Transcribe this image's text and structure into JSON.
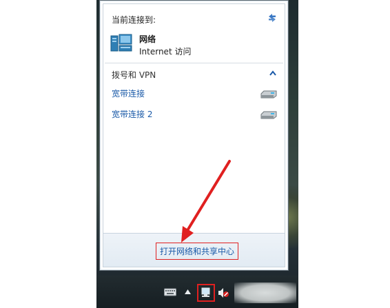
{
  "panel": {
    "connected_label": "当前连接到:",
    "network": {
      "name": "网络",
      "status": "Internet 访问",
      "icon": "network-icon"
    },
    "dialup_section": "拨号和 VPN",
    "connections": [
      {
        "label": "宽带连接",
        "icon": "modem-icon"
      },
      {
        "label": "宽带连接 2",
        "icon": "modem-icon"
      }
    ],
    "open_center_link": "打开网络和共享中心"
  },
  "taskbar": {
    "tray_icons": [
      "keyboard-icon",
      "show-hidden-icons-arrow",
      "network-tray-icon",
      "volume-muted-icon"
    ]
  },
  "annotation": {
    "arrow_color": "#e02020"
  },
  "colors": {
    "link": "#1a5aa8",
    "highlight_border": "#e02020"
  }
}
